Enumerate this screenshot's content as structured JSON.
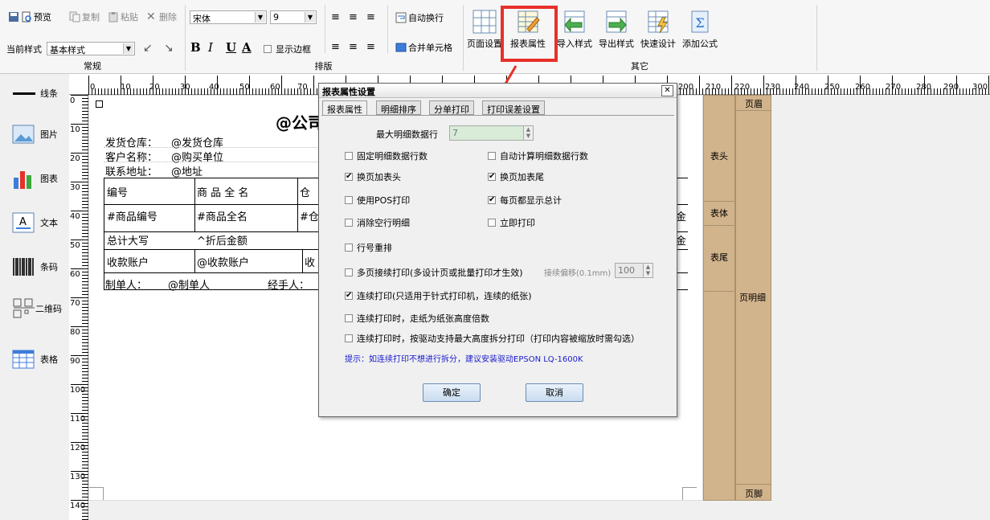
{
  "toolbar": {
    "preview": "预览",
    "copy": "复制",
    "paste": "粘贴",
    "delete": "删除",
    "current_style_label": "当前样式",
    "current_style_value": "基本样式",
    "font_name": "宋体",
    "font_size": "9",
    "bold": "B",
    "italic": "I",
    "underline": "U",
    "fontcolor": "A",
    "show_border": "显示边框",
    "auto_wrap": "自动换行",
    "merge_cells": "合并单元格",
    "page_setup": "页面设置",
    "report_props": "报表属性",
    "import_style": "导入样式",
    "export_style": "导出样式",
    "quick_design": "快速设计",
    "add_formula": "添加公式",
    "group_normal": "常规",
    "group_layout": "排版",
    "group_other": "其它"
  },
  "left_panel": [
    "线条",
    "图片",
    "图表",
    "文本",
    "条码",
    "二维码",
    "表格"
  ],
  "ruler_top": [
    "0",
    "10",
    "20",
    "30",
    "40",
    "50",
    "60",
    "70",
    "200",
    "210",
    "220",
    "230",
    "240",
    "250",
    "260",
    "270",
    "280",
    "290",
    "300"
  ],
  "ruler_left": [
    "0",
    "10",
    "20",
    "30",
    "40",
    "50",
    "60",
    "70",
    "80",
    "90",
    "100",
    "110",
    "120",
    "130",
    "140"
  ],
  "report": {
    "title": "@公司",
    "rows": [
      {
        "label": "发货仓库：",
        "value": "@发货仓库"
      },
      {
        "label": "客户名称：",
        "value": "@购买单位"
      },
      {
        "label": "联系地址：",
        "value": "@地址"
      }
    ],
    "headers": [
      "编号",
      "商 品 全 名",
      "仓"
    ],
    "detail": [
      "#商品编号",
      "#商品全名",
      "#仓"
    ],
    "summary_label": "总计大写",
    "summary_value": "^折后金额",
    "account_label": "收款账户",
    "account_value": "@收款账户",
    "account_tail": "收",
    "maker_label": "制单人：",
    "maker_value": "@制单人",
    "handler_label": "经手人：",
    "right_cut_1": "金",
    "right_cut_2": "金"
  },
  "bands": {
    "page_header": "页眉",
    "header": "表头",
    "body": "表体",
    "footer": "表尾",
    "page_detail": "页明细",
    "page_footer": "页脚"
  },
  "dialog": {
    "title": "报表属性设置",
    "tabs": [
      "报表属性",
      "明细排序",
      "分单打印",
      "打印误差设置"
    ],
    "max_rows_label": "最大明细数据行",
    "max_rows_value": "7",
    "options": [
      {
        "label": "固定明细数据行数",
        "checked": false
      },
      {
        "label": "自动计算明细数据行数",
        "checked": false
      },
      {
        "label": "换页加表头",
        "checked": true
      },
      {
        "label": "换页加表尾",
        "checked": true
      },
      {
        "label": "使用POS打印",
        "checked": false
      },
      {
        "label": "每页都显示总计",
        "checked": true
      },
      {
        "label": "消除空行明细",
        "checked": false
      },
      {
        "label": "立即打印",
        "checked": false
      },
      {
        "label": "行号重排",
        "checked": false
      },
      {
        "label": "多页接续打印(多设计页或批量打印才生效)",
        "checked": false
      },
      {
        "label": "连续打印(只适用于针式打印机，连续的纸张)",
        "checked": true
      },
      {
        "label": "连续打印时，走纸为纸张高度倍数",
        "checked": false
      },
      {
        "label": "连续打印时，按驱动支持最大高度拆分打印（打印内容被缩放时需勾选）",
        "checked": false
      }
    ],
    "offset_label": "接续偏移(0.1mm)",
    "offset_value": "100",
    "hint": "提示：如连续打印不想进行拆分，建议安装驱动EPSON LQ-1600K",
    "ok": "确定",
    "cancel": "取消"
  },
  "colors": {
    "highlight": "#e8302a",
    "band": "#d2b48c",
    "hint": "#1a1acc"
  }
}
